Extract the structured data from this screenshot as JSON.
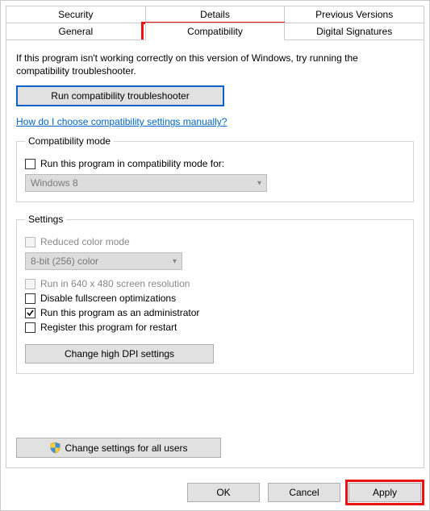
{
  "tabs_row1": [
    "Security",
    "Details",
    "Previous Versions"
  ],
  "tabs_row2": [
    "General",
    "Compatibility",
    "Digital Signatures"
  ],
  "active_tab": "Compatibility",
  "intro": "If this program isn't working correctly on this version of Windows, try running the compatibility troubleshooter.",
  "troubleshoot_btn": "Run compatibility troubleshooter",
  "manual_link": "How do I choose compatibility settings manually?",
  "compat_mode": {
    "legend": "Compatibility mode",
    "checkbox_label": "Run this program in compatibility mode for:",
    "checkbox_checked": false,
    "select_value": "Windows 8"
  },
  "settings": {
    "legend": "Settings",
    "reduced_color": {
      "label": "Reduced color mode",
      "checked": false,
      "enabled": false
    },
    "color_select": "8-bit (256) color",
    "run_640": {
      "label": "Run in 640 x 480 screen resolution",
      "checked": false,
      "enabled": false
    },
    "disable_fullscreen": {
      "label": "Disable fullscreen optimizations",
      "checked": false,
      "enabled": true
    },
    "run_admin": {
      "label": "Run this program as an administrator",
      "checked": true,
      "enabled": true
    },
    "register_restart": {
      "label": "Register this program for restart",
      "checked": false,
      "enabled": true
    },
    "dpi_btn": "Change high DPI settings"
  },
  "all_users_btn": "Change settings for all users",
  "buttons": {
    "ok": "OK",
    "cancel": "Cancel",
    "apply": "Apply"
  },
  "icons": {
    "shield": "shield-icon",
    "chevron": "chevron-down-icon"
  }
}
